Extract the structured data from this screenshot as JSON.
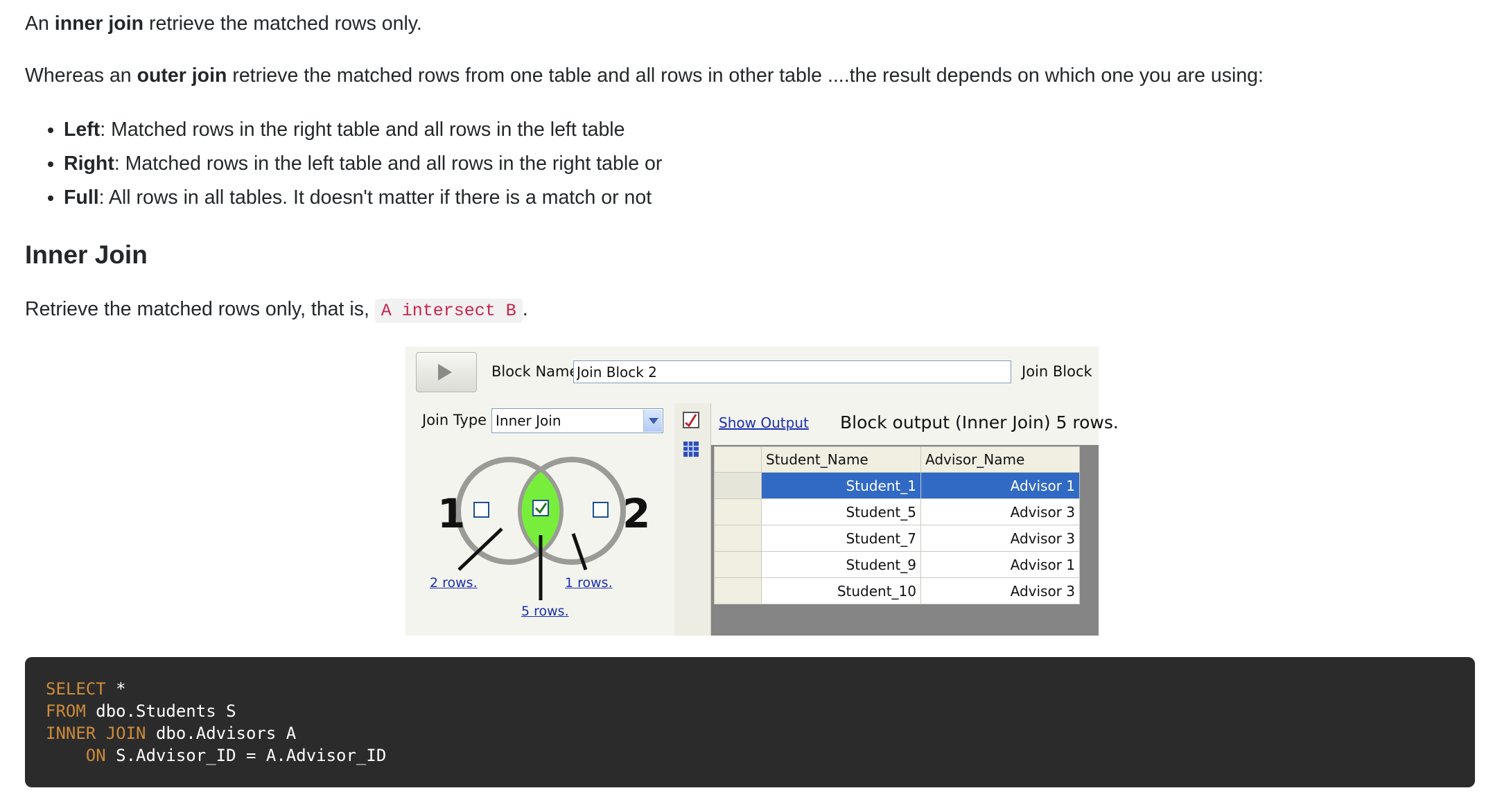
{
  "para1": {
    "prefix": "An ",
    "bold": "inner join",
    "suffix": " retrieve the matched rows only."
  },
  "para2": {
    "prefix": "Whereas an ",
    "bold": "outer join",
    "suffix": " retrieve the matched rows from one table and all rows in other table ....the result depends on which one you are using:"
  },
  "bullets": [
    {
      "term": "Left",
      "text": ": Matched rows in the right table and all rows in the left table"
    },
    {
      "term": "Right",
      "text": ": Matched rows in the left table and all rows in the right table or"
    },
    {
      "term": "Full",
      "text": ": All rows in all tables. It doesn't matter if there is a match or not"
    }
  ],
  "heading": "Inner Join",
  "para3": {
    "prefix": "Retrieve the matched rows only, that is, ",
    "code": "A intersect B",
    "suffix": "."
  },
  "panel": {
    "block_name_label": "Block Name",
    "block_name_value": "Join Block 2",
    "join_block_label": "Join Block",
    "join_type_label": "Join Type",
    "join_type_value": "Inner Join",
    "show_output": "Show Output",
    "output_caption": "Block output (Inner Join) 5 rows.",
    "venn": {
      "left_num": "1",
      "right_num": "2",
      "left_rows": "2 rows.",
      "right_rows": "1 rows.",
      "center_rows": "5 rows.",
      "left_checked": false,
      "center_checked": true,
      "right_checked": false,
      "center_color": "#77ee3c"
    },
    "grid": {
      "columns": [
        "Student_Name",
        "Advisor_Name"
      ],
      "rows": [
        [
          "Student_1",
          "Advisor 1"
        ],
        [
          "Student_5",
          "Advisor 3"
        ],
        [
          "Student_7",
          "Advisor 3"
        ],
        [
          "Student_9",
          "Advisor 1"
        ],
        [
          "Student_10",
          "Advisor 3"
        ]
      ],
      "selected_row": 0,
      "selection_color": "#316ac5"
    }
  },
  "code": {
    "lines": [
      [
        {
          "t": "SELECT",
          "k": true
        },
        {
          "t": " *",
          "k": false
        }
      ],
      [
        {
          "t": "FROM",
          "k": true
        },
        {
          "t": " dbo.Students S",
          "k": false
        }
      ],
      [
        {
          "t": "INNER JOIN",
          "k": true
        },
        {
          "t": " dbo.Advisors A",
          "k": false
        }
      ],
      [
        {
          "t": "    ",
          "k": false
        },
        {
          "t": "ON",
          "k": true
        },
        {
          "t": " S.Advisor_ID = A.Advisor_ID",
          "k": false
        }
      ]
    ],
    "keyword_color": "#cc8b3c",
    "background": "#2b2b2b"
  }
}
